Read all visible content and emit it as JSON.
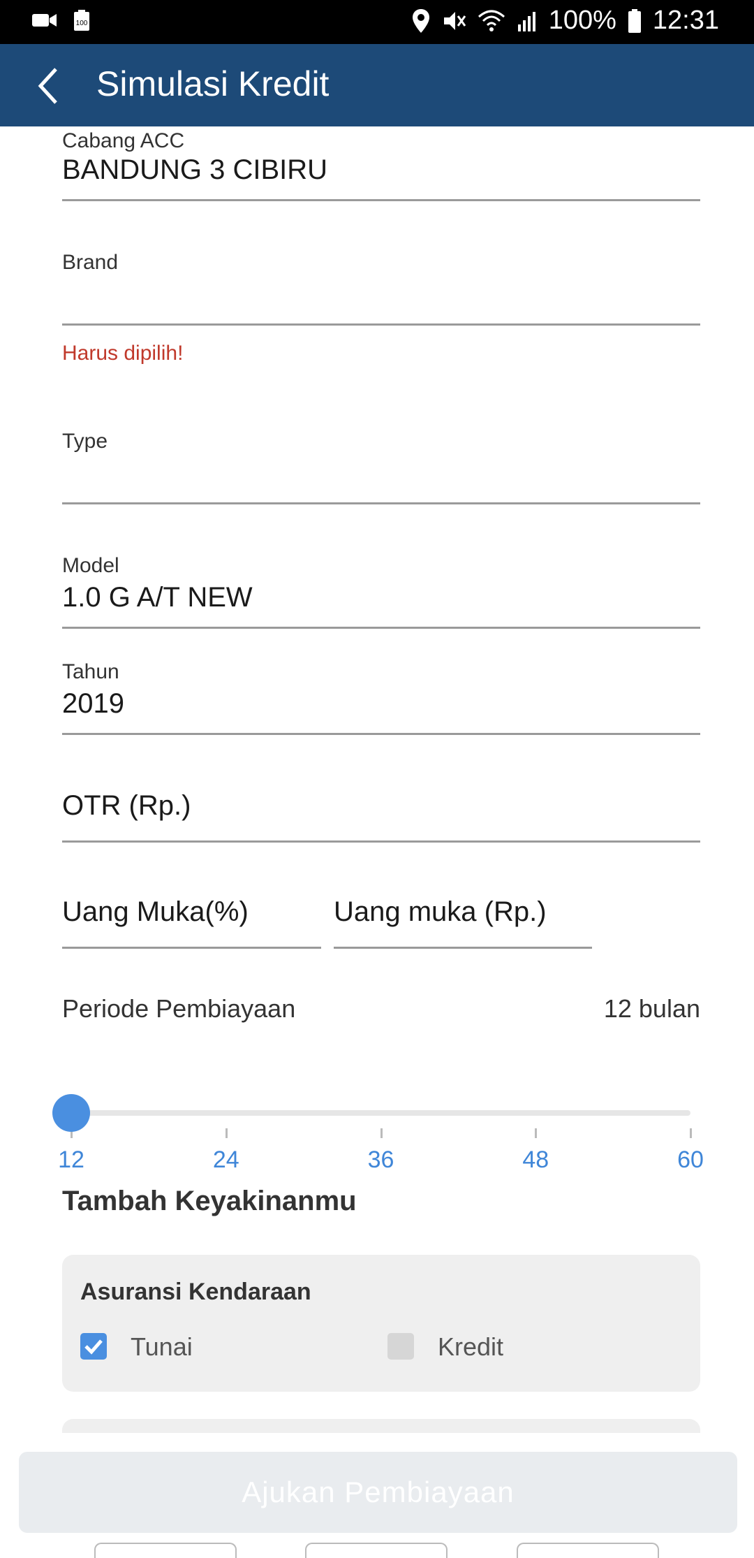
{
  "status_bar": {
    "battery_percent": "100%",
    "time": "12:31",
    "battery_small_label": "100"
  },
  "app_bar": {
    "title": "Simulasi Kredit"
  },
  "form": {
    "cabang": {
      "label": "Cabang ACC",
      "value": "BANDUNG 3 CIBIRU"
    },
    "brand": {
      "label": "Brand",
      "value": "",
      "error": "Harus dipilih!"
    },
    "type": {
      "label": "Type",
      "value": ""
    },
    "model": {
      "label": "Model",
      "value": "1.0 G A/T NEW"
    },
    "tahun": {
      "label": "Tahun",
      "value": "2019"
    },
    "otr": {
      "placeholder": "OTR (Rp.)"
    },
    "uang_muka_pct": {
      "placeholder": "Uang Muka(%)"
    },
    "uang_muka_rp": {
      "placeholder": "Uang muka (Rp.)"
    }
  },
  "period": {
    "label": "Periode Pembiayaan",
    "value_text": "12 bulan",
    "current": 12,
    "min": 12,
    "max": 60,
    "ticks": [
      "12",
      "24",
      "36",
      "48",
      "60"
    ]
  },
  "extras": {
    "section_title": "Tambah Keyakinanmu",
    "insurance": {
      "title": "Asuransi Kendaraan",
      "options": [
        {
          "label": "Tunai",
          "checked": true
        },
        {
          "label": "Kredit",
          "checked": false
        }
      ]
    }
  },
  "submit": {
    "label": "Ajukan Pembiayaan"
  },
  "colors": {
    "app_bar": "#1d4a78",
    "accent": "#4a8fe0",
    "error": "#c0392b"
  }
}
